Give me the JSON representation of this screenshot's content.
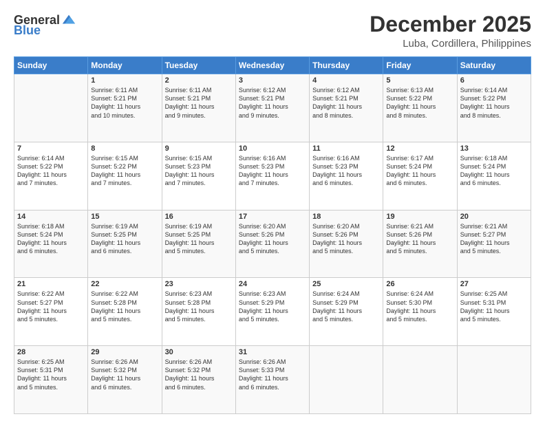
{
  "logo": {
    "general": "General",
    "blue": "Blue"
  },
  "title": "December 2025",
  "location": "Luba, Cordillera, Philippines",
  "days_of_week": [
    "Sunday",
    "Monday",
    "Tuesday",
    "Wednesday",
    "Thursday",
    "Friday",
    "Saturday"
  ],
  "weeks": [
    [
      {
        "day": "",
        "info": ""
      },
      {
        "day": "1",
        "info": "Sunrise: 6:11 AM\nSunset: 5:21 PM\nDaylight: 11 hours\nand 10 minutes."
      },
      {
        "day": "2",
        "info": "Sunrise: 6:11 AM\nSunset: 5:21 PM\nDaylight: 11 hours\nand 9 minutes."
      },
      {
        "day": "3",
        "info": "Sunrise: 6:12 AM\nSunset: 5:21 PM\nDaylight: 11 hours\nand 9 minutes."
      },
      {
        "day": "4",
        "info": "Sunrise: 6:12 AM\nSunset: 5:21 PM\nDaylight: 11 hours\nand 8 minutes."
      },
      {
        "day": "5",
        "info": "Sunrise: 6:13 AM\nSunset: 5:22 PM\nDaylight: 11 hours\nand 8 minutes."
      },
      {
        "day": "6",
        "info": "Sunrise: 6:14 AM\nSunset: 5:22 PM\nDaylight: 11 hours\nand 8 minutes."
      }
    ],
    [
      {
        "day": "7",
        "info": "Sunrise: 6:14 AM\nSunset: 5:22 PM\nDaylight: 11 hours\nand 7 minutes."
      },
      {
        "day": "8",
        "info": "Sunrise: 6:15 AM\nSunset: 5:22 PM\nDaylight: 11 hours\nand 7 minutes."
      },
      {
        "day": "9",
        "info": "Sunrise: 6:15 AM\nSunset: 5:23 PM\nDaylight: 11 hours\nand 7 minutes."
      },
      {
        "day": "10",
        "info": "Sunrise: 6:16 AM\nSunset: 5:23 PM\nDaylight: 11 hours\nand 7 minutes."
      },
      {
        "day": "11",
        "info": "Sunrise: 6:16 AM\nSunset: 5:23 PM\nDaylight: 11 hours\nand 6 minutes."
      },
      {
        "day": "12",
        "info": "Sunrise: 6:17 AM\nSunset: 5:24 PM\nDaylight: 11 hours\nand 6 minutes."
      },
      {
        "day": "13",
        "info": "Sunrise: 6:18 AM\nSunset: 5:24 PM\nDaylight: 11 hours\nand 6 minutes."
      }
    ],
    [
      {
        "day": "14",
        "info": "Sunrise: 6:18 AM\nSunset: 5:24 PM\nDaylight: 11 hours\nand 6 minutes."
      },
      {
        "day": "15",
        "info": "Sunrise: 6:19 AM\nSunset: 5:25 PM\nDaylight: 11 hours\nand 6 minutes."
      },
      {
        "day": "16",
        "info": "Sunrise: 6:19 AM\nSunset: 5:25 PM\nDaylight: 11 hours\nand 5 minutes."
      },
      {
        "day": "17",
        "info": "Sunrise: 6:20 AM\nSunset: 5:26 PM\nDaylight: 11 hours\nand 5 minutes."
      },
      {
        "day": "18",
        "info": "Sunrise: 6:20 AM\nSunset: 5:26 PM\nDaylight: 11 hours\nand 5 minutes."
      },
      {
        "day": "19",
        "info": "Sunrise: 6:21 AM\nSunset: 5:26 PM\nDaylight: 11 hours\nand 5 minutes."
      },
      {
        "day": "20",
        "info": "Sunrise: 6:21 AM\nSunset: 5:27 PM\nDaylight: 11 hours\nand 5 minutes."
      }
    ],
    [
      {
        "day": "21",
        "info": "Sunrise: 6:22 AM\nSunset: 5:27 PM\nDaylight: 11 hours\nand 5 minutes."
      },
      {
        "day": "22",
        "info": "Sunrise: 6:22 AM\nSunset: 5:28 PM\nDaylight: 11 hours\nand 5 minutes."
      },
      {
        "day": "23",
        "info": "Sunrise: 6:23 AM\nSunset: 5:28 PM\nDaylight: 11 hours\nand 5 minutes."
      },
      {
        "day": "24",
        "info": "Sunrise: 6:23 AM\nSunset: 5:29 PM\nDaylight: 11 hours\nand 5 minutes."
      },
      {
        "day": "25",
        "info": "Sunrise: 6:24 AM\nSunset: 5:29 PM\nDaylight: 11 hours\nand 5 minutes."
      },
      {
        "day": "26",
        "info": "Sunrise: 6:24 AM\nSunset: 5:30 PM\nDaylight: 11 hours\nand 5 minutes."
      },
      {
        "day": "27",
        "info": "Sunrise: 6:25 AM\nSunset: 5:31 PM\nDaylight: 11 hours\nand 5 minutes."
      }
    ],
    [
      {
        "day": "28",
        "info": "Sunrise: 6:25 AM\nSunset: 5:31 PM\nDaylight: 11 hours\nand 5 minutes."
      },
      {
        "day": "29",
        "info": "Sunrise: 6:26 AM\nSunset: 5:32 PM\nDaylight: 11 hours\nand 6 minutes."
      },
      {
        "day": "30",
        "info": "Sunrise: 6:26 AM\nSunset: 5:32 PM\nDaylight: 11 hours\nand 6 minutes."
      },
      {
        "day": "31",
        "info": "Sunrise: 6:26 AM\nSunset: 5:33 PM\nDaylight: 11 hours\nand 6 minutes."
      },
      {
        "day": "",
        "info": ""
      },
      {
        "day": "",
        "info": ""
      },
      {
        "day": "",
        "info": ""
      }
    ]
  ]
}
